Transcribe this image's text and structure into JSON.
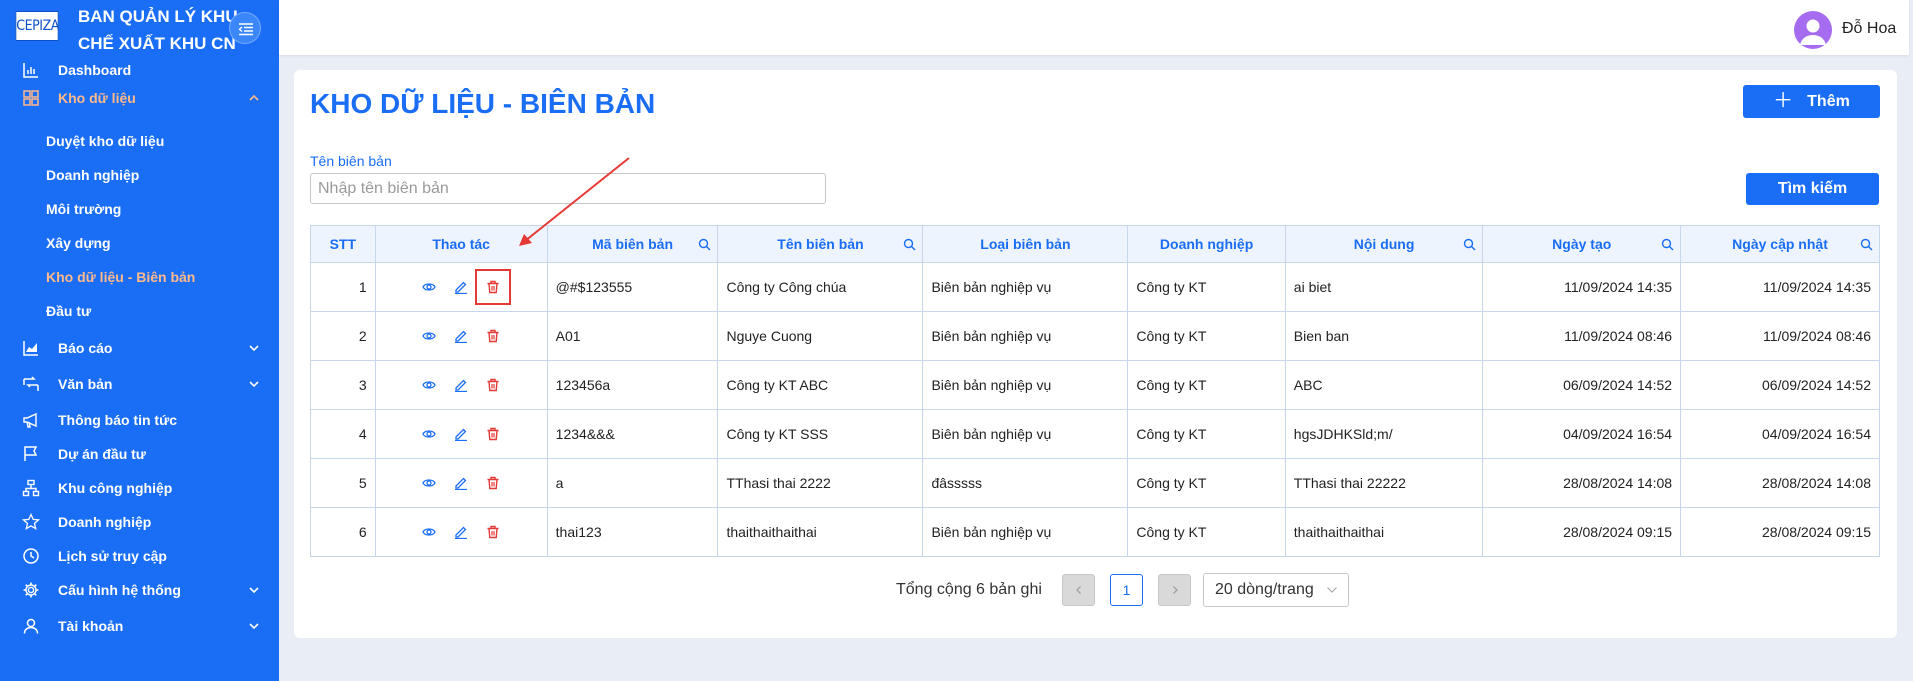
{
  "brand": {
    "logo_text": "CEPIZA",
    "title_line1": "BAN QUẢN LÝ KHU",
    "title_line2": "CHẾ XUẤT KHU CN"
  },
  "user": {
    "name": "Đỗ Hoa"
  },
  "sidebar": {
    "items": [
      {
        "label": "Dashboard",
        "icon": "bar-chart-icon"
      },
      {
        "label": "Kho dữ liệu",
        "icon": "grid-icon",
        "expanded": true
      },
      {
        "label": "Báo cáo",
        "icon": "area-chart-icon"
      },
      {
        "label": "Văn bản",
        "icon": "document-switch-icon"
      },
      {
        "label": "Thông báo tin tức",
        "icon": "megaphone-icon"
      },
      {
        "label": "Dự án đầu tư",
        "icon": "flag-icon"
      },
      {
        "label": "Khu công nghiệp",
        "icon": "org-chart-icon"
      },
      {
        "label": "Doanh nghiệp",
        "icon": "star-icon"
      },
      {
        "label": "Lịch sử truy cập",
        "icon": "clock-icon"
      },
      {
        "label": "Cấu hình hệ thống",
        "icon": "gear-icon"
      },
      {
        "label": "Tài khoản",
        "icon": "user-icon"
      }
    ],
    "sub_items": [
      "Duyệt kho dữ liệu",
      "Doanh nghiệp",
      "Môi trường",
      "Xây dựng",
      "Kho dữ liệu - Biên bản",
      "Đầu tư"
    ]
  },
  "page": {
    "title": "KHO DỮ LIỆU - BIÊN BẢN",
    "add_label": "Thêm",
    "search_label": "Tìm kiếm",
    "field_label": "Tên biên bản",
    "field_placeholder": "Nhập tên biên bản",
    "field_value": ""
  },
  "table": {
    "headers": [
      "STT",
      "Thao tác",
      "Mã biên bản",
      "Tên biên bản",
      "Loại biên bản",
      "Doanh nghiệp",
      "Nội dung",
      "Ngày tạo",
      "Ngày cập nhật"
    ],
    "rows": [
      [
        "1",
        "@#$123555",
        "Công ty Công chúa",
        "Biên bản nghiệp vụ",
        "Công ty KT",
        "ai biet",
        "11/09/2024 14:35",
        "11/09/2024 14:35"
      ],
      [
        "2",
        "A01",
        "Nguye Cuong",
        "Biên bản nghiệp vụ",
        "Công ty KT",
        "Bien ban",
        "11/09/2024 08:46",
        "11/09/2024 08:46"
      ],
      [
        "3",
        "123456a",
        "Công ty KT ABC",
        "Biên bản nghiệp vụ",
        "Công ty KT",
        "ABC",
        "06/09/2024 14:52",
        "06/09/2024 14:52"
      ],
      [
        "4",
        "1234&&&",
        "Công ty KT SSS",
        "Biên bản nghiệp vụ",
        "Công ty KT",
        "hgsJDHKSld;m/",
        "04/09/2024 16:54",
        "04/09/2024 16:54"
      ],
      [
        "5",
        "a",
        "TThasi thai 2222",
        "đâsssss",
        "Công ty KT",
        "TThasi thai 22222",
        "28/08/2024 14:08",
        "28/08/2024 14:08"
      ],
      [
        "6",
        "thai123",
        "thaithaithaithai",
        "Biên bản nghiệp vụ",
        "Công ty KT",
        "thaithaithaithai",
        "28/08/2024 09:15",
        "28/08/2024 09:15"
      ]
    ]
  },
  "pagination": {
    "total": "Tổng cộng 6 bản ghi",
    "current_page": "1",
    "page_size": "20 dòng/trang"
  },
  "colors": {
    "primary": "#1a6ef5",
    "sidebar_active": "#ffb98a",
    "danger": "#e53935"
  }
}
